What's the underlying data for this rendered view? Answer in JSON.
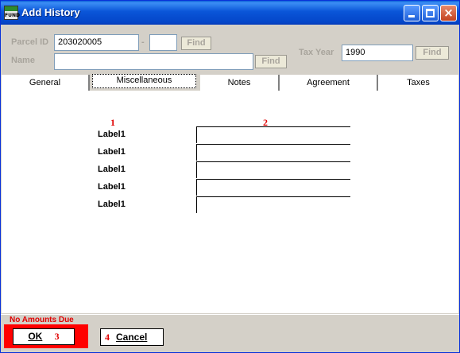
{
  "window": {
    "title": "Add History",
    "app_icon_text": "FUND"
  },
  "header": {
    "parcel_label": "Parcel ID",
    "parcel_value": "203020005",
    "dash": "-",
    "parcel_suffix_value": "",
    "find_label": "Find",
    "name_label": "Name",
    "name_value": "",
    "tax_year_label": "Tax Year",
    "tax_year_value": "1990"
  },
  "tabs": [
    "General",
    "Miscellaneous",
    "Notes",
    "Agreement",
    "Taxes"
  ],
  "active_tab": "Miscellaneous",
  "panel": {
    "col_markers": [
      "1",
      "2"
    ],
    "rows": [
      {
        "label": "Label1",
        "value": ""
      },
      {
        "label": "Label1",
        "value": ""
      },
      {
        "label": "Label1",
        "value": ""
      },
      {
        "label": "Label1",
        "value": ""
      },
      {
        "label": "Label1",
        "value": ""
      }
    ]
  },
  "footer": {
    "status": "No Amounts Due",
    "ok_label": "OK",
    "ok_marker": "3",
    "cancel_label": "Cancel",
    "cancel_marker": "4"
  },
  "colors": {
    "titlebar": "#0a55d8",
    "window_bg": "#d4d0c8",
    "marker_red": "#e00000",
    "ok_highlight": "#ff0000"
  }
}
